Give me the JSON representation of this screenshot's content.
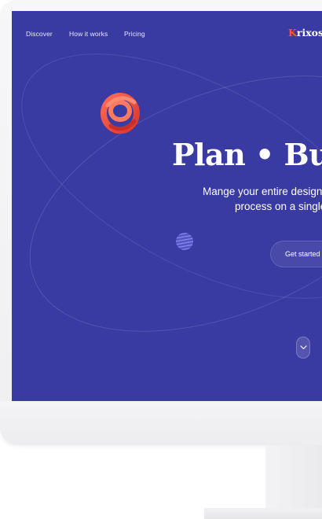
{
  "nav": {
    "items": [
      {
        "label": "Discover"
      },
      {
        "label": "How it works"
      },
      {
        "label": "Pricing"
      }
    ]
  },
  "logo": {
    "initial": "K",
    "rest": "rixos"
  },
  "hero": {
    "headline": "Plan • Buil",
    "subline_1": "Mange your entire design",
    "subline_2": "process on a single",
    "cta_label": "Get started"
  },
  "icons": {
    "scroll": "chevron-down-icon",
    "spiral": "red-spiral-3d-shape",
    "sphere": "striped-sphere-shape"
  },
  "colors": {
    "screen_background": "#3a3aa3",
    "logo_accent": "#ff5a1f",
    "spiral": "#e8493d"
  }
}
